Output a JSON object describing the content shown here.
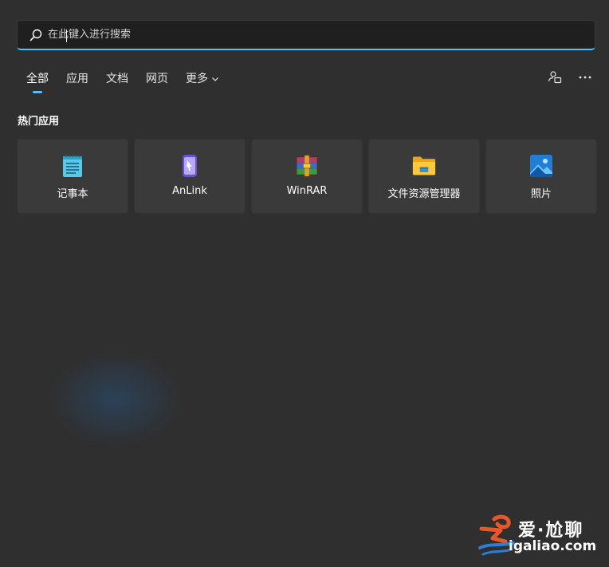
{
  "search": {
    "placeholder": "在此键入进行搜索",
    "value": ""
  },
  "tabs": [
    {
      "label": "全部",
      "active": true
    },
    {
      "label": "应用"
    },
    {
      "label": "文档"
    },
    {
      "label": "网页"
    },
    {
      "label": "更多"
    }
  ],
  "section": {
    "title": "热门应用"
  },
  "apps": [
    {
      "label": "记事本",
      "icon": "notepad-icon"
    },
    {
      "label": "AnLink",
      "icon": "anlink-icon"
    },
    {
      "label": "WinRAR",
      "icon": "winrar-icon"
    },
    {
      "label": "文件资源管理器",
      "icon": "folder-icon"
    },
    {
      "label": "照片",
      "icon": "photos-icon"
    }
  ],
  "watermark": {
    "line1": "爱·尬聊",
    "line2": "igaliao.com"
  },
  "colors": {
    "accent": "#4cc2ff",
    "background": "#2f2f2f",
    "tile": "#3a3a3a"
  }
}
